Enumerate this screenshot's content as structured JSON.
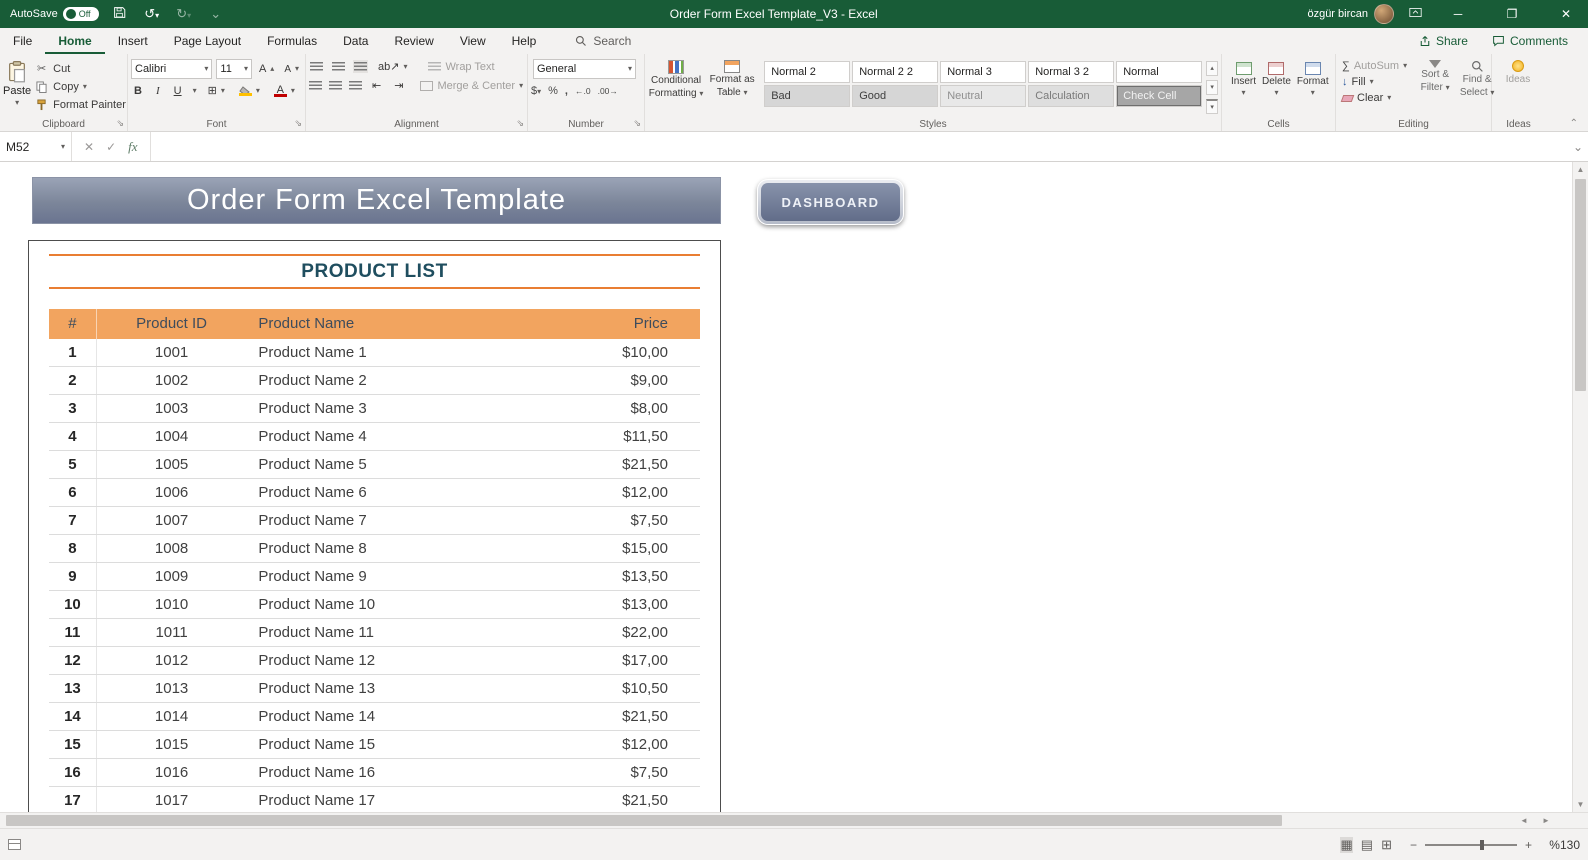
{
  "titlebar": {
    "autosave_label": "AutoSave",
    "autosave_state": "Off",
    "title": "Order Form Excel Template_V3  -  Excel",
    "user": "özgür bircan"
  },
  "tabs": {
    "file": "File",
    "items": [
      "Home",
      "Insert",
      "Page Layout",
      "Formulas",
      "Data",
      "Review",
      "View",
      "Help"
    ],
    "active": "Home",
    "search": "Search",
    "share": "Share",
    "comments": "Comments"
  },
  "ribbon": {
    "clipboard": {
      "label": "Clipboard",
      "paste": "Paste",
      "cut": "Cut",
      "copy": "Copy",
      "format_painter": "Format Painter"
    },
    "font": {
      "label": "Font",
      "name": "Calibri",
      "size": "11",
      "bold": "B",
      "italic": "I",
      "underline": "U"
    },
    "alignment": {
      "label": "Alignment",
      "wrap_text": "Wrap Text",
      "merge_center": "Merge & Center"
    },
    "number": {
      "label": "Number",
      "format": "General"
    },
    "styles": {
      "label": "Styles",
      "conditional_line1": "Conditional",
      "conditional_line2": "Formatting",
      "format_table_line1": "Format as",
      "format_table_line2": "Table",
      "gallery": [
        {
          "name": "Normal 2",
          "bg": "#ffffff",
          "fg": "#252423"
        },
        {
          "name": "Normal 2 2",
          "bg": "#ffffff",
          "fg": "#252423"
        },
        {
          "name": "Normal 3",
          "bg": "#ffffff",
          "fg": "#252423"
        },
        {
          "name": "Normal 3 2",
          "bg": "#ffffff",
          "fg": "#252423"
        },
        {
          "name": "Normal",
          "bg": "#ffffff",
          "fg": "#252423"
        },
        {
          "name": "Bad",
          "bg": "#d6d6d6",
          "fg": "#3f3f3f"
        },
        {
          "name": "Good",
          "bg": "#d6d6d6",
          "fg": "#3f3f3f"
        },
        {
          "name": "Neutral",
          "bg": "#e8e8e8",
          "fg": "#8f8f8f"
        },
        {
          "name": "Calculation",
          "bg": "#dedede",
          "fg": "#7a7a7a"
        },
        {
          "name": "Check Cell",
          "bg": "#a6a6a6",
          "fg": "#f2f2f2",
          "border": "#6e6e6e"
        }
      ]
    },
    "cells": {
      "label": "Cells",
      "insert": "Insert",
      "delete": "Delete",
      "format": "Format"
    },
    "editing": {
      "label": "Editing",
      "autosum": "AutoSum",
      "fill": "Fill",
      "clear": "Clear",
      "sort_line1": "Sort &",
      "sort_line2": "Filter",
      "find_line1": "Find &",
      "find_line2": "Select"
    },
    "ideas": {
      "label": "Ideas",
      "button": "Ideas"
    }
  },
  "formula_bar": {
    "name_box": "M52"
  },
  "sheet": {
    "banner_title": "Order Form Excel Template",
    "dashboard_button": "DASHBOARD",
    "section_title": "PRODUCT LIST",
    "table": {
      "headers": [
        "#",
        "Product ID",
        "Product Name",
        "Price"
      ],
      "rows": [
        {
          "num": "1",
          "id": "1001",
          "name": "Product Name 1",
          "price": "$10,00"
        },
        {
          "num": "2",
          "id": "1002",
          "name": "Product Name 2",
          "price": "$9,00"
        },
        {
          "num": "3",
          "id": "1003",
          "name": "Product Name 3",
          "price": "$8,00"
        },
        {
          "num": "4",
          "id": "1004",
          "name": "Product Name 4",
          "price": "$11,50"
        },
        {
          "num": "5",
          "id": "1005",
          "name": "Product Name 5",
          "price": "$21,50"
        },
        {
          "num": "6",
          "id": "1006",
          "name": "Product Name 6",
          "price": "$12,00"
        },
        {
          "num": "7",
          "id": "1007",
          "name": "Product Name 7",
          "price": "$7,50"
        },
        {
          "num": "8",
          "id": "1008",
          "name": "Product Name 8",
          "price": "$15,00"
        },
        {
          "num": "9",
          "id": "1009",
          "name": "Product Name 9",
          "price": "$13,50"
        },
        {
          "num": "10",
          "id": "1010",
          "name": "Product Name 10",
          "price": "$13,00"
        },
        {
          "num": "11",
          "id": "1011",
          "name": "Product Name 11",
          "price": "$22,00"
        },
        {
          "num": "12",
          "id": "1012",
          "name": "Product Name 12",
          "price": "$17,00"
        },
        {
          "num": "13",
          "id": "1013",
          "name": "Product Name 13",
          "price": "$10,50"
        },
        {
          "num": "14",
          "id": "1014",
          "name": "Product Name 14",
          "price": "$21,50"
        },
        {
          "num": "15",
          "id": "1015",
          "name": "Product Name 15",
          "price": "$12,00"
        },
        {
          "num": "16",
          "id": "1016",
          "name": "Product Name 16",
          "price": "$7,50"
        },
        {
          "num": "17",
          "id": "1017",
          "name": "Product Name 17",
          "price": "$21,50"
        }
      ]
    }
  },
  "status_bar": {
    "zoom": "%130"
  },
  "colors": {
    "titlebar_green": "#185C37",
    "table_header_orange": "#F2A45F",
    "rule_orange": "#E97E32",
    "banner_top": "#9AA3B6",
    "banner_bottom": "#6A7490",
    "heading_navy": "#1F4E5F"
  }
}
